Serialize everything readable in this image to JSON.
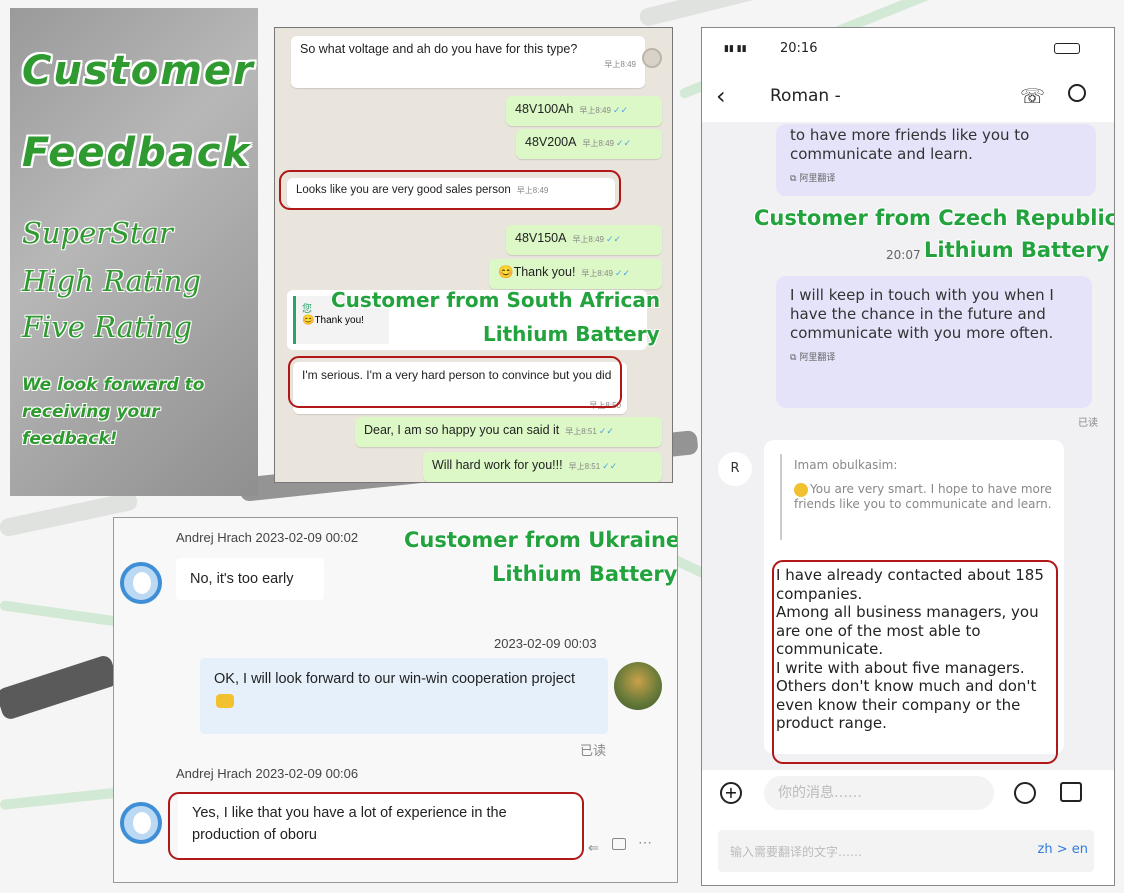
{
  "promo": {
    "title_line1": "Customer",
    "title_line2": "Feedback",
    "ratings": [
      "SuperStar",
      "High Rating",
      "Five Rating"
    ],
    "tagline_lines": [
      "We look forward to",
      "receiving your",
      "feedback!"
    ]
  },
  "whatsapp": {
    "messages": [
      {
        "text": "So what voltage and ah do you have for this type?",
        "time": "早上8:49",
        "dir": "in"
      },
      {
        "text": "48V100Ah",
        "time": "早上8:49",
        "dir": "out"
      },
      {
        "text": "48V200A",
        "time": "早上8:49",
        "dir": "out"
      },
      {
        "text": "Looks like you are very good sales person",
        "time": "早上8:49",
        "dir": "in"
      },
      {
        "text": "48V150A",
        "time": "早上8:49",
        "dir": "out"
      },
      {
        "text": "Thank you!",
        "time": "早上8:49",
        "dir": "out"
      },
      {
        "text": "I'm serious. I'm a very hard person to convince but you did",
        "time": "早上8:50",
        "dir": "in"
      },
      {
        "text": "Dear, I am so happy you can said it",
        "time": "早上8:51",
        "dir": "out"
      },
      {
        "text": "Will hard work for you!!!",
        "time": "早上8:51",
        "dir": "out"
      }
    ],
    "quote_sender": "您",
    "quote_text": "Thank you!",
    "caption_line1": "Customer from South African",
    "caption_line2": "Lithium Battery"
  },
  "ukraine": {
    "caption_line1": "Customer from Ukraine",
    "caption_line2": "Lithium Battery",
    "msg1_header": "Andrej Hrach   2023-02-09 00:02",
    "msg1_text": "No, it's too early",
    "msg2_time": "2023-02-09 00:03",
    "msg2_text": "OK, I will look forward to our win-win cooperation project",
    "read_label": "已读",
    "msg3_header": "Andrej Hrach   2023-02-09 00:06",
    "msg3_text": "Yes, I like that you have a lot of experience in the production of oboru"
  },
  "phone": {
    "time": "20:16",
    "contact": "Roman -",
    "bubble1": "to have more friends like you to communicate and learn.",
    "translate_label": "阿里翻译",
    "caption_line1": "Customer from Czech Republic",
    "caption_time": "20:07",
    "caption_line2": "Lithium Battery",
    "bubble2": "I will keep in touch with you when I have the chance in the future and communicate with you more often.",
    "read_label": "已读",
    "avatar_letter": "R",
    "quote_name": "Imam obulkasim:",
    "quote_text": "You are very smart. I hope to have more friends like you to communicate and learn.",
    "reply_text": "I have already contacted about 185 companies.\nAmong all business managers, you are one of the most able to communicate.\nI write with about five managers. Others don't know much and don't even know their company or the product range.",
    "input_placeholder": "你的消息……",
    "translate_placeholder": "输入需要翻译的文字……",
    "lang_pair": "zh > en"
  }
}
